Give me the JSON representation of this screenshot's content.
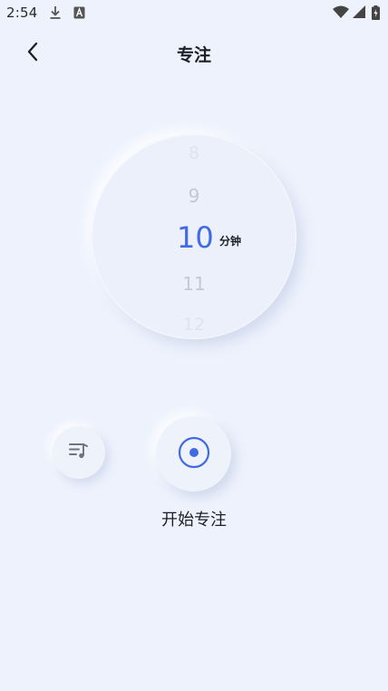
{
  "status_bar": {
    "time": "2:54",
    "icons": [
      "download-icon",
      "a-box-icon",
      "wifi-icon",
      "signal-icon",
      "battery-icon"
    ]
  },
  "header": {
    "title": "专注",
    "back_icon": "chevron-left-icon"
  },
  "picker": {
    "items": [
      "8",
      "9",
      "10",
      "11",
      "12"
    ],
    "selected_value": "10",
    "unit": "分钟",
    "accent_color": "#4169E6"
  },
  "controls": {
    "playlist_icon": "music-playlist-icon",
    "start_icon": "record-target-icon",
    "start_label": "开始专注"
  },
  "colors": {
    "background": "#EDF2FD",
    "accent": "#4169E6"
  }
}
